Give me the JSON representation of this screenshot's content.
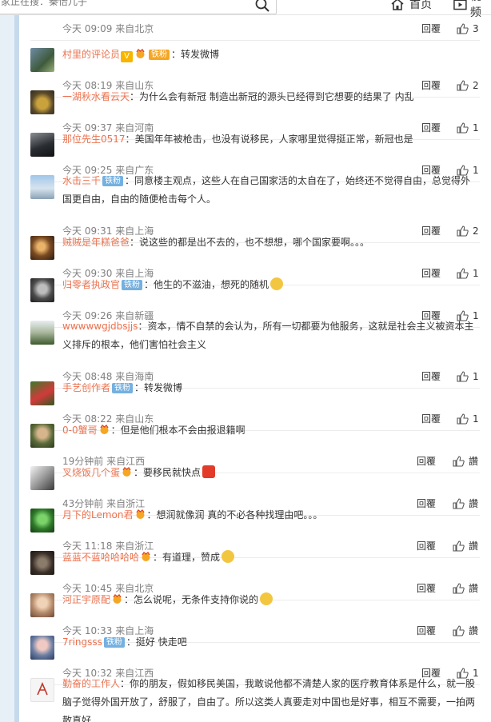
{
  "search": {
    "value": "家正在搜：秦怡儿子"
  },
  "nav": {
    "home_label": "首页",
    "video_label": "视频"
  },
  "actions": {
    "reply_label": "回覆",
    "praise_label": "讚"
  },
  "colors": {
    "username": "#eb7350",
    "meta": "#808080",
    "badge": "#74b0e0",
    "background": "#e8f0f7"
  },
  "comments": [
    {
      "time": "今天 09:09 来自北京",
      "likes": "3"
    },
    {
      "user": "村里的评论员",
      "badge": "铁粉",
      "sep": "：",
      "text": "转发微博",
      "time": "今天 08:19 来自山东",
      "likes": "2"
    },
    {
      "user": "一湖秋水看云天",
      "sep": "：",
      "text": "为什么会有新冠 制造出新冠的源头已经得到它想要的结果了 内乱",
      "time": "今天 09:37 来自河南",
      "likes": "1"
    },
    {
      "user": "那位先生0517",
      "sep": "：",
      "text": "美国年年被枪击，也没有说移民，人家哪里觉得挺正常，新冠也是",
      "time": "今天 09:25 来自广东",
      "likes": "1"
    },
    {
      "user": "水击三千",
      "badge": "铁粉",
      "sep": "：",
      "text": "同意楼主观点，这些人在自己国家活的太自在了，始终还不觉得自由，总觉得外国更自由，自由的随便枪击每个人。",
      "time": "今天 09:31 来自上海",
      "likes": "2"
    },
    {
      "user": "贼贼是年糕爸爸",
      "sep": "：",
      "text": "说这些的都是出不去的，也不想想，哪个国家要啊。。。",
      "time": "今天 09:30 来自上海",
      "likes": "1"
    },
    {
      "user": "归零者执政官",
      "badge": "铁粉",
      "sep": "：",
      "text": "他生的不滋油，想死的随机",
      "time": "今天 09:26 来自新疆",
      "likes": "1"
    },
    {
      "user": "wwwwwgjdbsjjs",
      "sep": "：",
      "text": "资本，情不自禁的会认为，所有一切都要为他服务，这就是社会主义被资本主义排斥的根本，他们害怕社会主义",
      "time": "今天 08:48 来自海南",
      "likes": "1"
    },
    {
      "user": "手艺创作者",
      "badge": "铁粉",
      "sep": "：",
      "text": "转发微博",
      "time": "今天 08:22 来自山东",
      "likes": "1"
    },
    {
      "user": "0-0蟹哥",
      "sep": "：",
      "text": "但是他们根本不会由报退籍啊",
      "time": "19分钟前 来自江西",
      "likes": "讚"
    },
    {
      "user": "叉烧饭几个蛋",
      "sep": "：",
      "text": "要移民就快点",
      "time": "43分钟前 来自浙江",
      "likes": "讚"
    },
    {
      "user": "月下的Lemon君",
      "sep": "：",
      "text": "想润就像润 真的不必各种找理由吧。。。",
      "time": "今天 11:18 来自浙江",
      "likes": "讚"
    },
    {
      "user": "蓝蓝不蓝哈哈哈哈",
      "sep": "：",
      "text": "有道理，赞成",
      "time": "今天 10:45 来自北京",
      "likes": "讚"
    },
    {
      "user": "河正宇原配",
      "sep": "：",
      "text": "怎么说呢，无条件支持你说的",
      "time": "今天 10:33 来自上海",
      "likes": "讚"
    },
    {
      "user": "7ringsss",
      "badge": "铁粉",
      "sep": "：",
      "text": "挺好 快走吧",
      "time": "今天 10:32 来自江西",
      "likes": "1"
    },
    {
      "user": "勤奋的工作人",
      "sep": "：",
      "text": "你的朋友，假如移民美国，我敢说他都不清楚人家的医疗教育体系是什么，就一股脑子觉得外国开放了，舒服了，自由了。所以这类人真要走对中国也是好事，相互不需要，一拍两散真好"
    }
  ]
}
